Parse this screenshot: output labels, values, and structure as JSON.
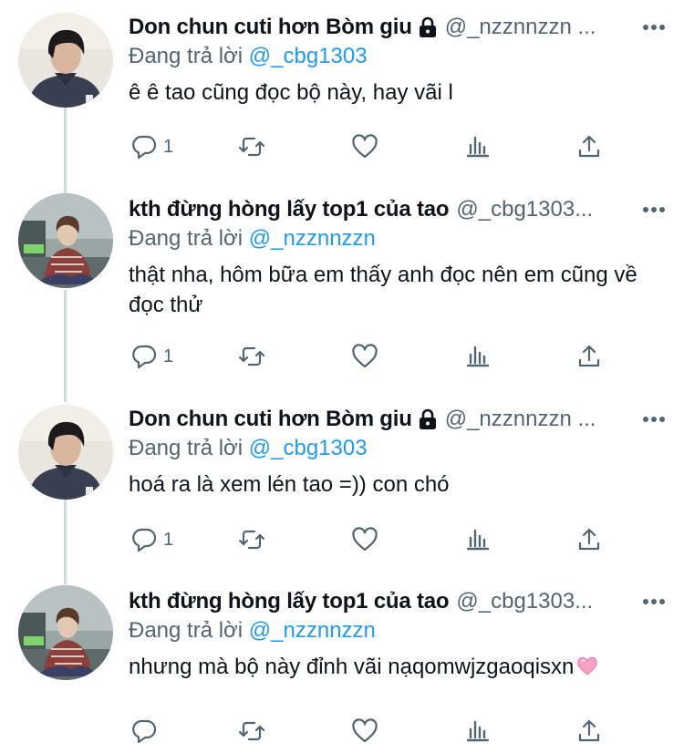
{
  "tweets": [
    {
      "name": "Don chun cuti hơn Bòm giu",
      "handle": "@_nzznnzzn ...",
      "locked": true,
      "replying_label": "Đang trả lời",
      "replying_to": "@_cbg1303",
      "text": "ê ê tao cũng đọc bộ này, hay vãi l",
      "reply_count": "1",
      "avatar": "user-a"
    },
    {
      "name": "kth đừng hòng lấy top1 của tao",
      "handle": "@_cbg1303...",
      "locked": false,
      "replying_label": "Đang trả lời",
      "replying_to": "@_nzznnzzn",
      "text": "thật nha, hôm bữa em thấy anh đọc nên em cũng về đọc thử",
      "reply_count": "1",
      "avatar": "user-b"
    },
    {
      "name": "Don chun cuti hơn Bòm giu",
      "handle": "@_nzznnzzn ...",
      "locked": true,
      "replying_label": "Đang trả lời",
      "replying_to": "@_cbg1303",
      "text": "hoá ra là xem lén tao =)) con chó",
      "reply_count": "1",
      "avatar": "user-a"
    },
    {
      "name": "kth đừng hòng lấy top1 của tao",
      "handle": "@_cbg1303...",
      "locked": false,
      "replying_label": "Đang trả lời",
      "replying_to": "@_nzznnzzn",
      "text": "nhưng mà bộ này đỉnh vãi nạqomwjzgaoqisxn",
      "reply_count": "",
      "avatar": "user-b"
    }
  ],
  "icons": {
    "lock": "lock-icon",
    "more": "more-icon",
    "reply": "reply-icon",
    "retweet": "retweet-icon",
    "like": "heart-icon",
    "views": "views-icon",
    "share": "share-icon",
    "emoji": "pink-heart-emoji"
  },
  "colors": {
    "text": "#0f1419",
    "secondary": "#536471",
    "mention": "#1d9bf0",
    "thread_line": "#cfd9de"
  }
}
